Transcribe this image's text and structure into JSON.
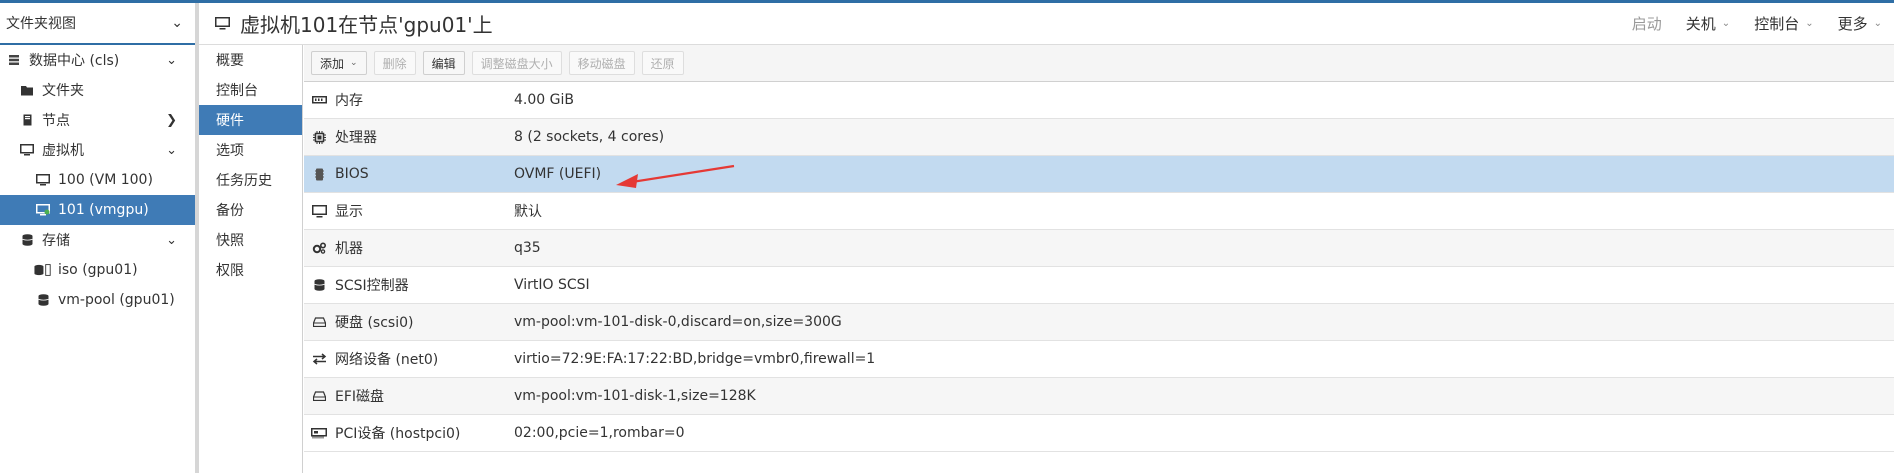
{
  "tree": {
    "view_label": "文件夹视图",
    "items": [
      {
        "label": "数据中心 (cls)",
        "icon": "server-rack-icon"
      },
      {
        "label": "文件夹",
        "icon": "folder-icon"
      },
      {
        "label": "节点",
        "icon": "node-icon"
      },
      {
        "label": "虚拟机",
        "icon": "monitor-icon"
      },
      {
        "label": "100 (VM 100)",
        "icon": "monitor-icon"
      },
      {
        "label": "101 (vmgpu)",
        "icon": "monitor-running-icon"
      },
      {
        "label": "存储",
        "icon": "database-icon"
      },
      {
        "label": "iso (gpu01)",
        "icon": "database-icon"
      },
      {
        "label": "vm-pool (gpu01)",
        "icon": "database-icon"
      }
    ]
  },
  "header": {
    "title": "虚拟机101在节点'gpu01'上",
    "buttons": {
      "start": "启动",
      "shutdown": "关机",
      "console": "控制台",
      "more": "更多"
    }
  },
  "nav": {
    "items": [
      "概要",
      "控制台",
      "硬件",
      "选项",
      "任务历史",
      "备份",
      "快照",
      "权限"
    ],
    "selected": "硬件"
  },
  "toolbar": {
    "add": "添加",
    "delete": "删除",
    "edit": "编辑",
    "resize": "调整磁盘大小",
    "move": "移动磁盘",
    "revert": "还原"
  },
  "hardware": [
    {
      "key": "内存",
      "value": "4.00 GiB",
      "icon": "memory-icon"
    },
    {
      "key": "处理器",
      "value": "8 (2 sockets, 4 cores)",
      "icon": "cpu-icon"
    },
    {
      "key": "BIOS",
      "value": "OVMF (UEFI)",
      "icon": "bios-chip-icon"
    },
    {
      "key": "显示",
      "value": "默认",
      "icon": "display-icon"
    },
    {
      "key": "机器",
      "value": "q35",
      "icon": "cogs-icon"
    },
    {
      "key": "SCSI控制器",
      "value": "VirtIO SCSI",
      "icon": "database-icon"
    },
    {
      "key": "硬盘 (scsi0)",
      "value": "vm-pool:vm-101-disk-0,discard=on,size=300G",
      "icon": "hard-disk-icon"
    },
    {
      "key": "网络设备 (net0)",
      "value": "virtio=72:9E:FA:17:22:BD,bridge=vmbr0,firewall=1",
      "icon": "network-exchange-icon"
    },
    {
      "key": "EFI磁盘",
      "value": "vm-pool:vm-101-disk-1,size=128K",
      "icon": "hard-disk-icon"
    },
    {
      "key": "PCI设备 (hostpci0)",
      "value": "02:00,pcie=1,rombar=0",
      "icon": "pci-card-icon"
    }
  ],
  "colors": {
    "accent": "#3f7bb6",
    "selected_row": "#c2daf0",
    "annotation_arrow": "#e53935"
  }
}
